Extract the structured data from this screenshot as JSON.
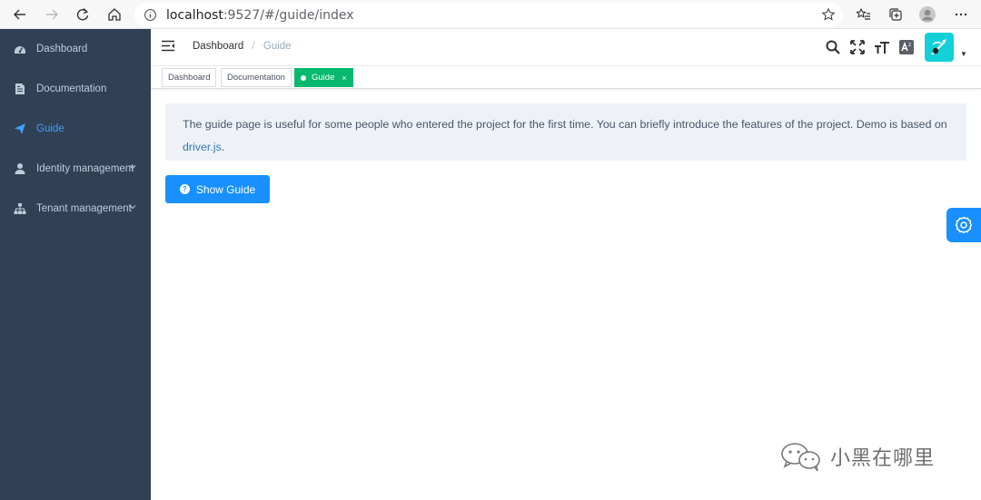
{
  "browser": {
    "url_host": "localhost",
    "url_path": ":9527/#/guide/index"
  },
  "sidebar": {
    "items": [
      {
        "label": "Dashboard",
        "icon": "dashboard-icon"
      },
      {
        "label": "Documentation",
        "icon": "documentation-icon"
      },
      {
        "label": "Guide",
        "icon": "guide-icon",
        "active": true
      },
      {
        "label": "Identity management",
        "icon": "user-icon",
        "expandable": true
      },
      {
        "label": "Tenant management",
        "icon": "tree-icon",
        "expandable": true
      }
    ]
  },
  "navbar": {
    "breadcrumb": [
      "Dashboard",
      "Guide"
    ],
    "breadcrumb_separator": "/"
  },
  "tags": [
    {
      "label": "Dashboard"
    },
    {
      "label": "Documentation"
    },
    {
      "label": "Guide",
      "active": true,
      "close": "×"
    }
  ],
  "main": {
    "intro_text": "The guide page is useful for some people who entered the project for the first time. You can briefly introduce the features of the project. Demo is based on ",
    "link_text": "driver.js",
    "intro_end": ".",
    "button_label": "Show Guide",
    "button_icon": "?"
  },
  "watermark": {
    "text": "小黑在哪里"
  },
  "colors": {
    "sidebar_bg": "#304156",
    "sidebar_text": "#bfcbd9",
    "sidebar_active": "#409eff",
    "tag_active": "#07b96f",
    "primary": "#1890ff",
    "avatar_bg": "#12d0d8"
  }
}
